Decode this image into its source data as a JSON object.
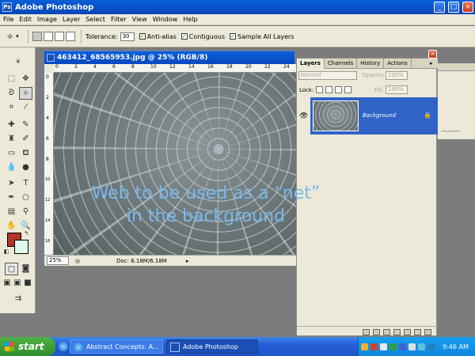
{
  "window": {
    "title": "Adobe Photoshop",
    "min": "_",
    "max": "□",
    "close": "×"
  },
  "menu": [
    "File",
    "Edit",
    "Image",
    "Layer",
    "Select",
    "Filter",
    "View",
    "Window",
    "Help"
  ],
  "options": {
    "tolerance_label": "Tolerance:",
    "tolerance_value": "30",
    "anti_alias": "Anti-alias",
    "contiguous": "Contiguous",
    "sample_all": "Sample All Layers"
  },
  "document": {
    "title": "463412_68565953.jpg @ 25% (RGB/8)",
    "zoom": "25%",
    "doc_info": "Doc: 6.18M/6.18M",
    "ruler_ticks": [
      "0",
      "2",
      "4",
      "6",
      "8",
      "10",
      "12",
      "14",
      "16",
      "18",
      "20",
      "22",
      "24"
    ],
    "ruler_ticks_left": [
      "0",
      "2",
      "4",
      "6",
      "8",
      "10",
      "12",
      "14",
      "16"
    ]
  },
  "layers_palette": {
    "tabs": [
      "Layers",
      "Channels",
      "History",
      "Actions"
    ],
    "blend_mode": "Normal",
    "opacity_label": "Opacity:",
    "opacity_value": "100%",
    "lock_label": "Lock:",
    "fill_label": "Fill:",
    "fill_value": "100%",
    "layer_name": "Background"
  },
  "overlay_caption": {
    "line1": "Web to be used as a “net”",
    "line2": "in the background"
  },
  "taskbar": {
    "start": "start",
    "tasks": [
      "Abstract Concepts: A...",
      "Adobe Photoshop"
    ],
    "clock": "9:46 AM"
  },
  "colors": {
    "foreground": "#b33229",
    "background": "#dffaec",
    "caption": "#7ab8ee",
    "layer_selected": "#2f64c6"
  }
}
